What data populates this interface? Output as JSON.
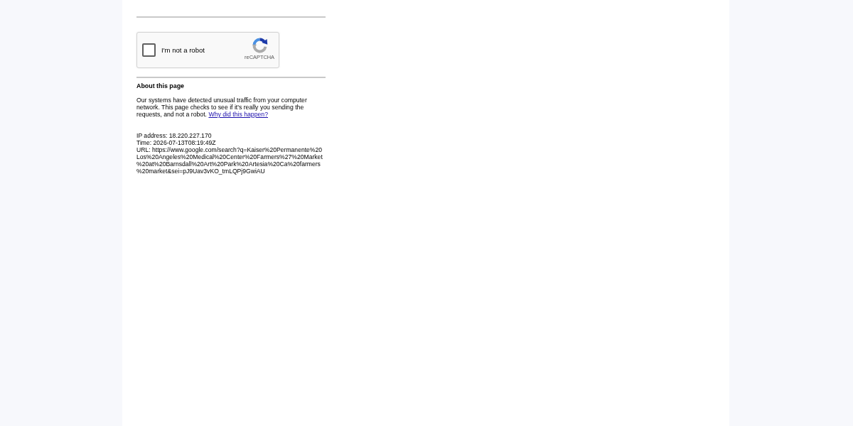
{
  "captcha": {
    "label": "I'm not a robot",
    "checked": false,
    "brand": "reCAPTCHA"
  },
  "about": {
    "heading": "About this page",
    "text": "Our systems have detected unusual traffic from your computer network. This page checks to see if it's really you sending the requests, and not a robot.",
    "link": "Why did this happen?"
  },
  "details": [
    {
      "kind": "plain",
      "text": "IP address: 18.220.227.170"
    },
    {
      "kind": "plain",
      "text": "Time: 2026-07-13T08:19:49Z"
    },
    {
      "kind": "url",
      "text": "URL: https://www.google.com/search?q=Kaiser%20Permanente%20Los%20Angeles%20Medical%20Center%20Farmers%27%20Market%20at%20Barnsdall%20Art%20Park%20Artesia%20Ca%20farmers%20market&sei=pJ9Uav3vKO_tmLQPj9GwiAU"
    }
  ]
}
